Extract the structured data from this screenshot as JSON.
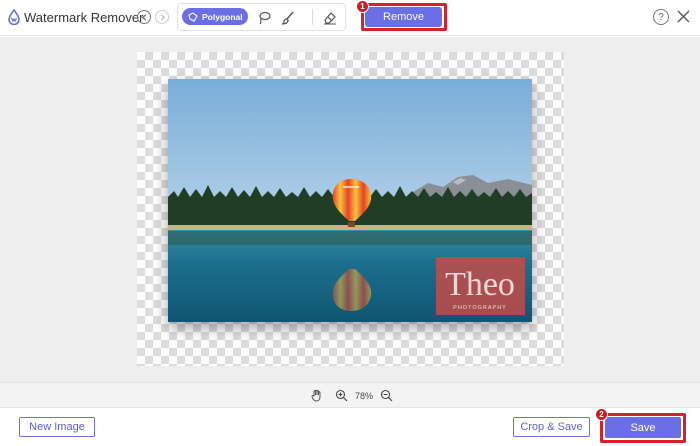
{
  "app": {
    "title": "Watermark Remover",
    "logo_icon": "watermark-remover-logo-icon"
  },
  "history": {
    "undo_icon": "undo-icon",
    "redo_icon": "redo-icon"
  },
  "tools": {
    "polygonal_label": "Polygonal",
    "items": [
      "polygonal-tool",
      "lasso-tool",
      "brush-tool",
      "eraser-tool"
    ],
    "active": "Polygonal"
  },
  "actions": {
    "remove_label": "Remove",
    "remove_step": "1",
    "save_label": "Save",
    "save_step": "2",
    "new_image_label": "New Image",
    "crop_save_label": "Crop & Save"
  },
  "zoom": {
    "level": "78%"
  },
  "watermark": {
    "main_text": "Theo",
    "sub_text": "PHOTOGRAPHY"
  },
  "colors": {
    "accent": "#6a6fe8",
    "highlight": "#d8202a"
  }
}
